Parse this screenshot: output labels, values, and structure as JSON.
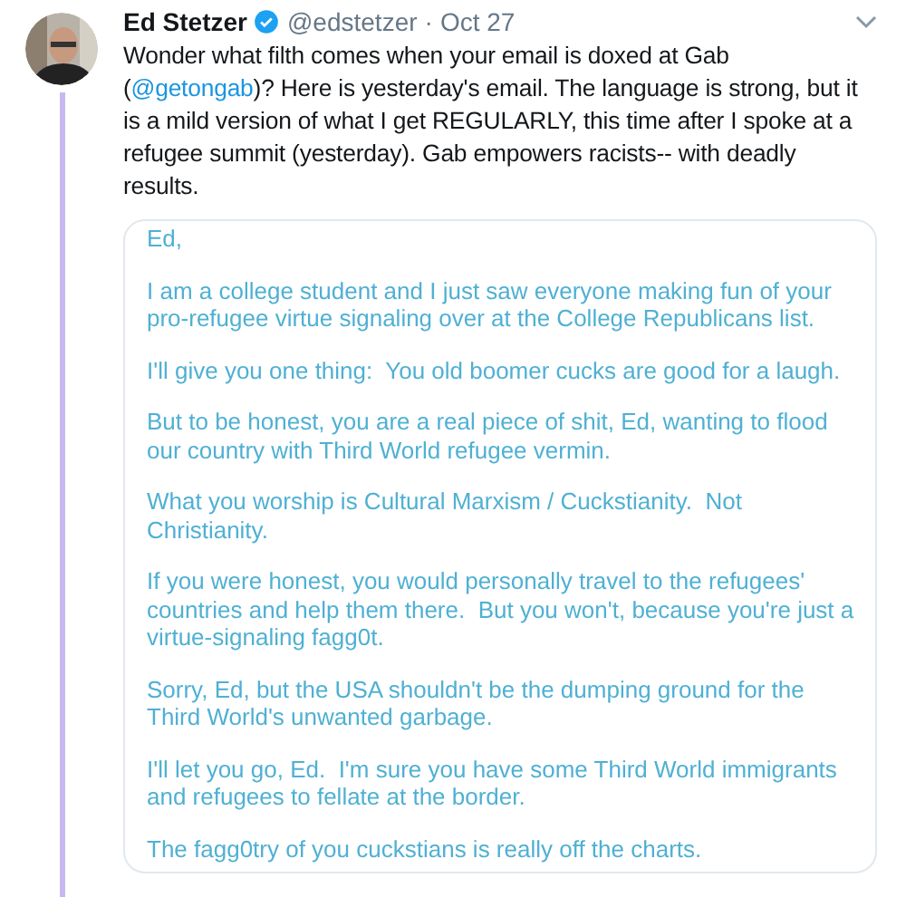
{
  "tweet": {
    "author": "Ed Stetzer",
    "verified": true,
    "handle": "@edstetzer",
    "separator": "·",
    "date": "Oct 27",
    "text_parts": [
      {
        "kind": "text",
        "text": "Wonder what filth comes when your email is doxed at Gab ("
      },
      {
        "kind": "mention",
        "text": "@getongab"
      },
      {
        "kind": "text",
        "text": ")? Here is yesterday's email. The language is strong, but it is a mild version of what I get REGULARLY, this time after I spoke at a refugee summit (yesterday). Gab empowers racists-- with deadly results."
      }
    ],
    "email_paragraphs": [
      "Ed,",
      "I am a college student and I just saw everyone making fun of your pro-refugee virtue signaling over at the College Republicans list.",
      "I'll give you one thing:  You old boomer cucks are good for a laugh.",
      "But to be honest, you are a real piece of shit, Ed, wanting to flood our country with Third World refugee vermin.",
      "What you worship is Cultural Marxism / Cuckstianity.  Not Christianity.",
      "If you were honest, you would personally travel to the refugees' countries and help them there.  But you won't, because you're just a virtue-signaling fagg0t.",
      "Sorry, Ed, but the USA shouldn't be the dumping ground for the Third World's unwanted garbage.",
      "I'll let you go, Ed.  I'm sure you have some Third World immigrants and refugees to fellate at the border.",
      "The fagg0try of you cuckstians is really off the charts."
    ]
  }
}
